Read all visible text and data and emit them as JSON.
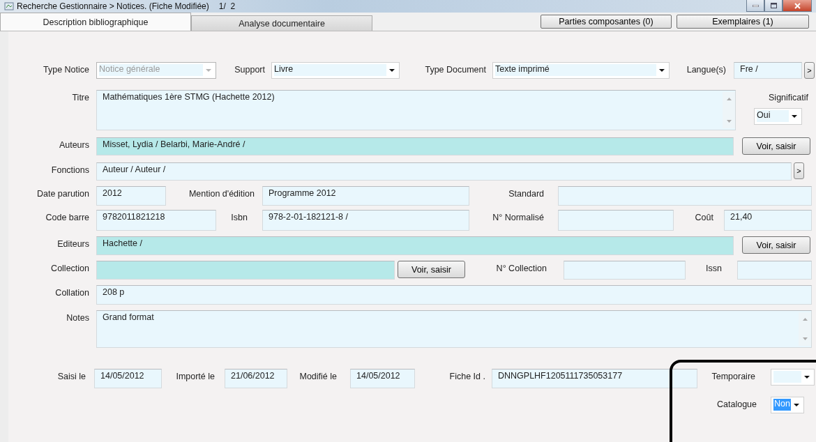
{
  "window": {
    "title": "Recherche Gestionnaire > Notices. (Fiche Modifiée)",
    "record_counter": "1/  2"
  },
  "tabs": [
    {
      "label": "Description bibliographique",
      "selected": true
    },
    {
      "label": "Analyse documentaire",
      "selected": false
    }
  ],
  "header_buttons": [
    "Parties composantes (0)",
    "Exemplaires (1)"
  ],
  "rows": [
    {
      "items": [
        {
          "kind": "label",
          "text": "Type Notice"
        },
        {
          "kind": "select",
          "value": "Notice générale",
          "disabled": true
        },
        {
          "kind": "label",
          "text": "Support"
        },
        {
          "kind": "select",
          "value": "Livre",
          "disabled": false
        },
        {
          "kind": "label",
          "text": "Type Document"
        },
        {
          "kind": "select",
          "value": "Texte imprimé",
          "disabled": false
        },
        {
          "kind": "label",
          "text": "Langue(s)"
        },
        {
          "kind": "input",
          "value": "Fre /"
        },
        {
          "kind": "more",
          "text": ">"
        }
      ]
    },
    {
      "items": [
        {
          "kind": "label",
          "text": "Titre"
        },
        {
          "kind": "textarea",
          "value": "Mathématiques 1ère STMG (Hachette 2012)"
        },
        {
          "kind": "group",
          "items": [
            {
              "kind": "label",
              "text": "Significatif"
            },
            {
              "kind": "select",
              "value": "Oui",
              "disabled": false
            }
          ]
        }
      ]
    },
    {
      "items": [
        {
          "kind": "label",
          "text": "Auteurs"
        },
        {
          "kind": "lookup",
          "value": "Misset, Lydia / Belarbi, Marie-André /"
        },
        {
          "kind": "button",
          "text": "Voir, saisir"
        }
      ]
    },
    {
      "items": [
        {
          "kind": "label",
          "text": "Fonctions"
        },
        {
          "kind": "input",
          "value": "Auteur / Auteur /"
        },
        {
          "kind": "more",
          "text": ">"
        }
      ]
    },
    {
      "items": [
        {
          "kind": "label",
          "text": "Date parution"
        },
        {
          "kind": "input",
          "value": "2012"
        },
        {
          "kind": "label",
          "text": "Mention d'édition"
        },
        {
          "kind": "input",
          "value": "Programme 2012"
        },
        {
          "kind": "label",
          "text": "Standard"
        },
        {
          "kind": "input"
        }
      ]
    },
    {
      "items": [
        {
          "kind": "label",
          "text": "Code barre"
        },
        {
          "kind": "input",
          "value": "9782011821218"
        },
        {
          "kind": "label",
          "text": "Isbn"
        },
        {
          "kind": "input",
          "value": "978-2-01-182121-8 /"
        },
        {
          "kind": "label",
          "text": "N° Normalisé"
        },
        {
          "kind": "input"
        },
        {
          "kind": "label",
          "text": "Coût"
        },
        {
          "kind": "input",
          "value": "21,40"
        }
      ]
    },
    {
      "items": [
        {
          "kind": "label",
          "text": "Editeurs"
        },
        {
          "kind": "lookup",
          "value": "Hachette /"
        },
        {
          "kind": "button",
          "text": "Voir, saisir"
        }
      ]
    },
    {
      "items": [
        {
          "kind": "label",
          "text": "Collection"
        },
        {
          "kind": "lookup"
        },
        {
          "kind": "button",
          "text": "Voir, saisir"
        },
        {
          "kind": "label",
          "text": "N° Collection"
        },
        {
          "kind": "input"
        },
        {
          "kind": "label",
          "text": "Issn"
        },
        {
          "kind": "input"
        }
      ]
    },
    {
      "items": [
        {
          "kind": "label",
          "text": "Collation"
        },
        {
          "kind": "input",
          "value": "208 p"
        }
      ]
    },
    {
      "items": [
        {
          "kind": "label",
          "text": "Notes"
        },
        {
          "kind": "textarea",
          "value": "Grand format"
        }
      ]
    },
    {
      "items": [
        {
          "kind": "label",
          "text": "Saisi le"
        },
        {
          "kind": "input",
          "value": "14/05/2012"
        },
        {
          "kind": "label",
          "text": "Importé le"
        },
        {
          "kind": "input",
          "value": "21/06/2012"
        },
        {
          "kind": "label",
          "text": "Modifié le"
        },
        {
          "kind": "input",
          "value": "14/05/2012"
        },
        {
          "kind": "label",
          "text": "Fiche Id ."
        },
        {
          "kind": "input",
          "value": "DNNGPLHF1205111735053177"
        },
        {
          "kind": "label",
          "text": "Temporaire"
        },
        {
          "kind": "select",
          "disabled": false
        }
      ]
    },
    {
      "items": [
        {
          "kind": "label",
          "text": "Catalogue"
        },
        {
          "kind": "select",
          "value": "Non",
          "disabled": false,
          "value_selected": true
        }
      ]
    }
  ],
  "highlight_frame": true
}
